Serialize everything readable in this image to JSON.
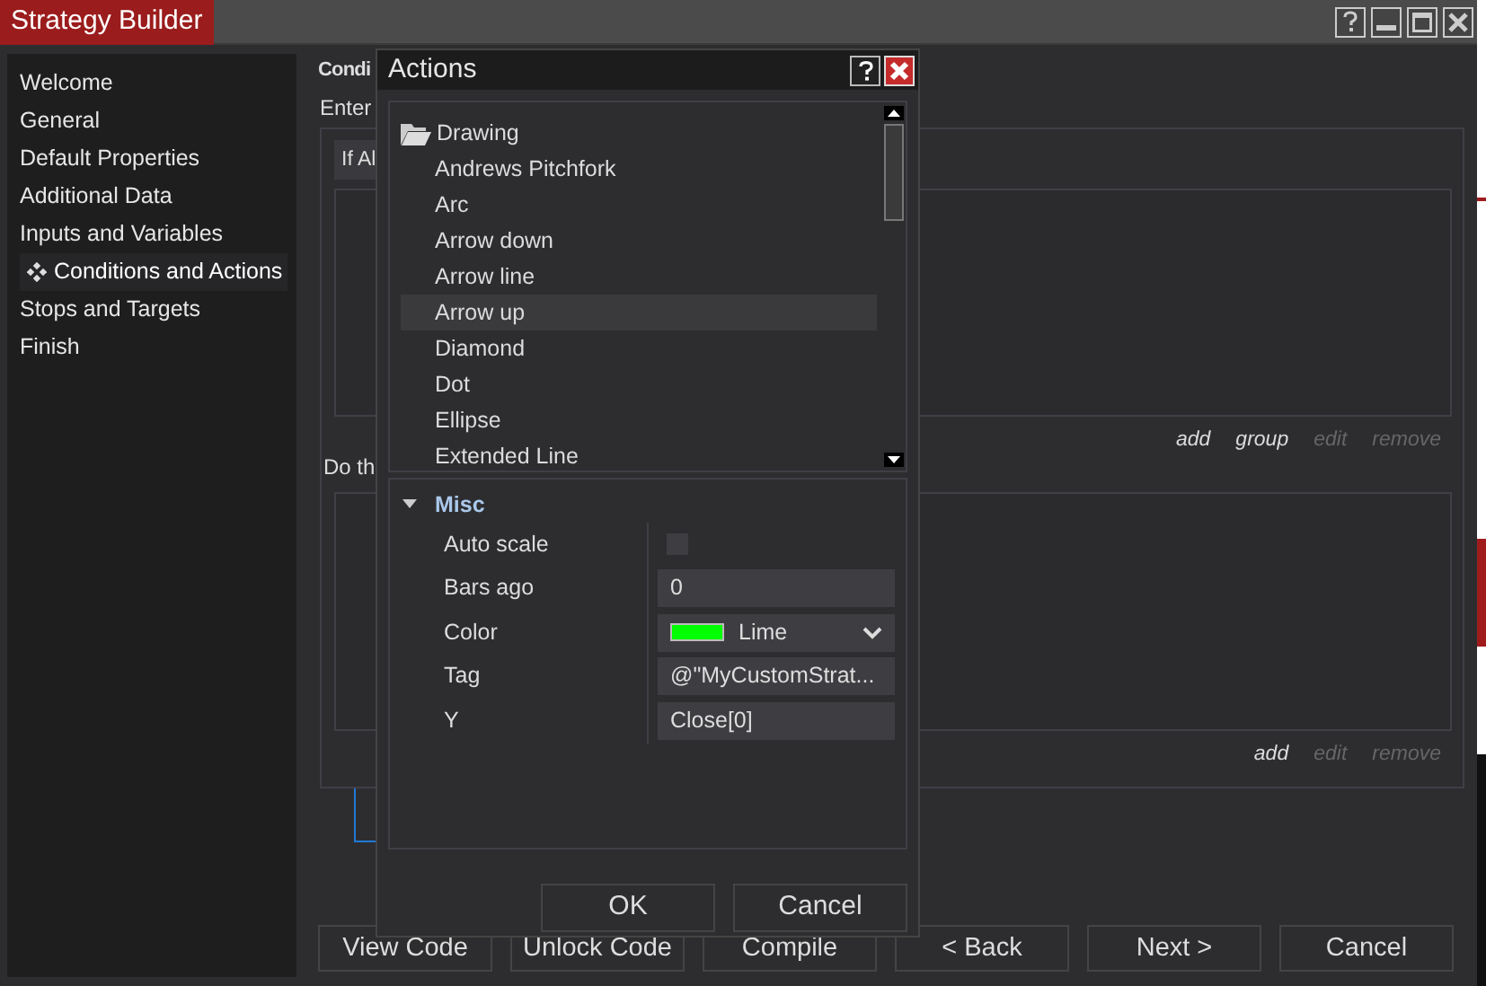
{
  "window": {
    "title": "Strategy Builder"
  },
  "sidebar": {
    "items": [
      {
        "label": "Welcome",
        "selected": false
      },
      {
        "label": "General",
        "selected": false
      },
      {
        "label": "Default Properties",
        "selected": false
      },
      {
        "label": "Additional Data",
        "selected": false
      },
      {
        "label": "Inputs and Variables",
        "selected": false
      },
      {
        "label": "Conditions and Actions",
        "selected": true
      },
      {
        "label": "Stops and Targets",
        "selected": false
      },
      {
        "label": "Finish",
        "selected": false
      }
    ]
  },
  "page": {
    "heading": "Condi",
    "instruction": "Enter",
    "condition_button": "If Al",
    "condition_links": [
      {
        "label": "add",
        "disabled": false
      },
      {
        "label": "group",
        "disabled": false
      },
      {
        "label": "edit",
        "disabled": true
      },
      {
        "label": "remove",
        "disabled": true
      }
    ],
    "actions_label": "Do th",
    "action_links": [
      {
        "label": "add",
        "disabled": false
      },
      {
        "label": "edit",
        "disabled": true
      },
      {
        "label": "remove",
        "disabled": true
      }
    ]
  },
  "buttons": [
    "View Code",
    "Unlock Code",
    "Compile",
    "< Back",
    "Next >",
    "Cancel"
  ],
  "dialog": {
    "title": "Actions",
    "tree": {
      "label": "Drawing",
      "expanded": true,
      "children": [
        {
          "label": "Andrews Pitchfork",
          "selected": false
        },
        {
          "label": "Arc",
          "selected": false
        },
        {
          "label": "Arrow down",
          "selected": false
        },
        {
          "label": "Arrow line",
          "selected": false
        },
        {
          "label": "Arrow up",
          "selected": true
        },
        {
          "label": "Diamond",
          "selected": false
        },
        {
          "label": "Dot",
          "selected": false
        },
        {
          "label": "Ellipse",
          "selected": false
        },
        {
          "label": "Extended Line",
          "selected": false
        }
      ]
    },
    "properties": {
      "category": "Misc",
      "expanded": true,
      "rows": [
        {
          "kind": "checkbox",
          "label": "Auto scale",
          "checked": false
        },
        {
          "kind": "text",
          "label": "Bars ago",
          "value": "0"
        },
        {
          "kind": "color",
          "label": "Color",
          "value": "Lime",
          "color": "#00ff00"
        },
        {
          "kind": "text",
          "label": "Tag",
          "value": "@\"MyCustomStrat..."
        },
        {
          "kind": "text",
          "label": "Y",
          "value": "Close[0]"
        }
      ]
    },
    "buttons": [
      "OK",
      "Cancel"
    ]
  }
}
